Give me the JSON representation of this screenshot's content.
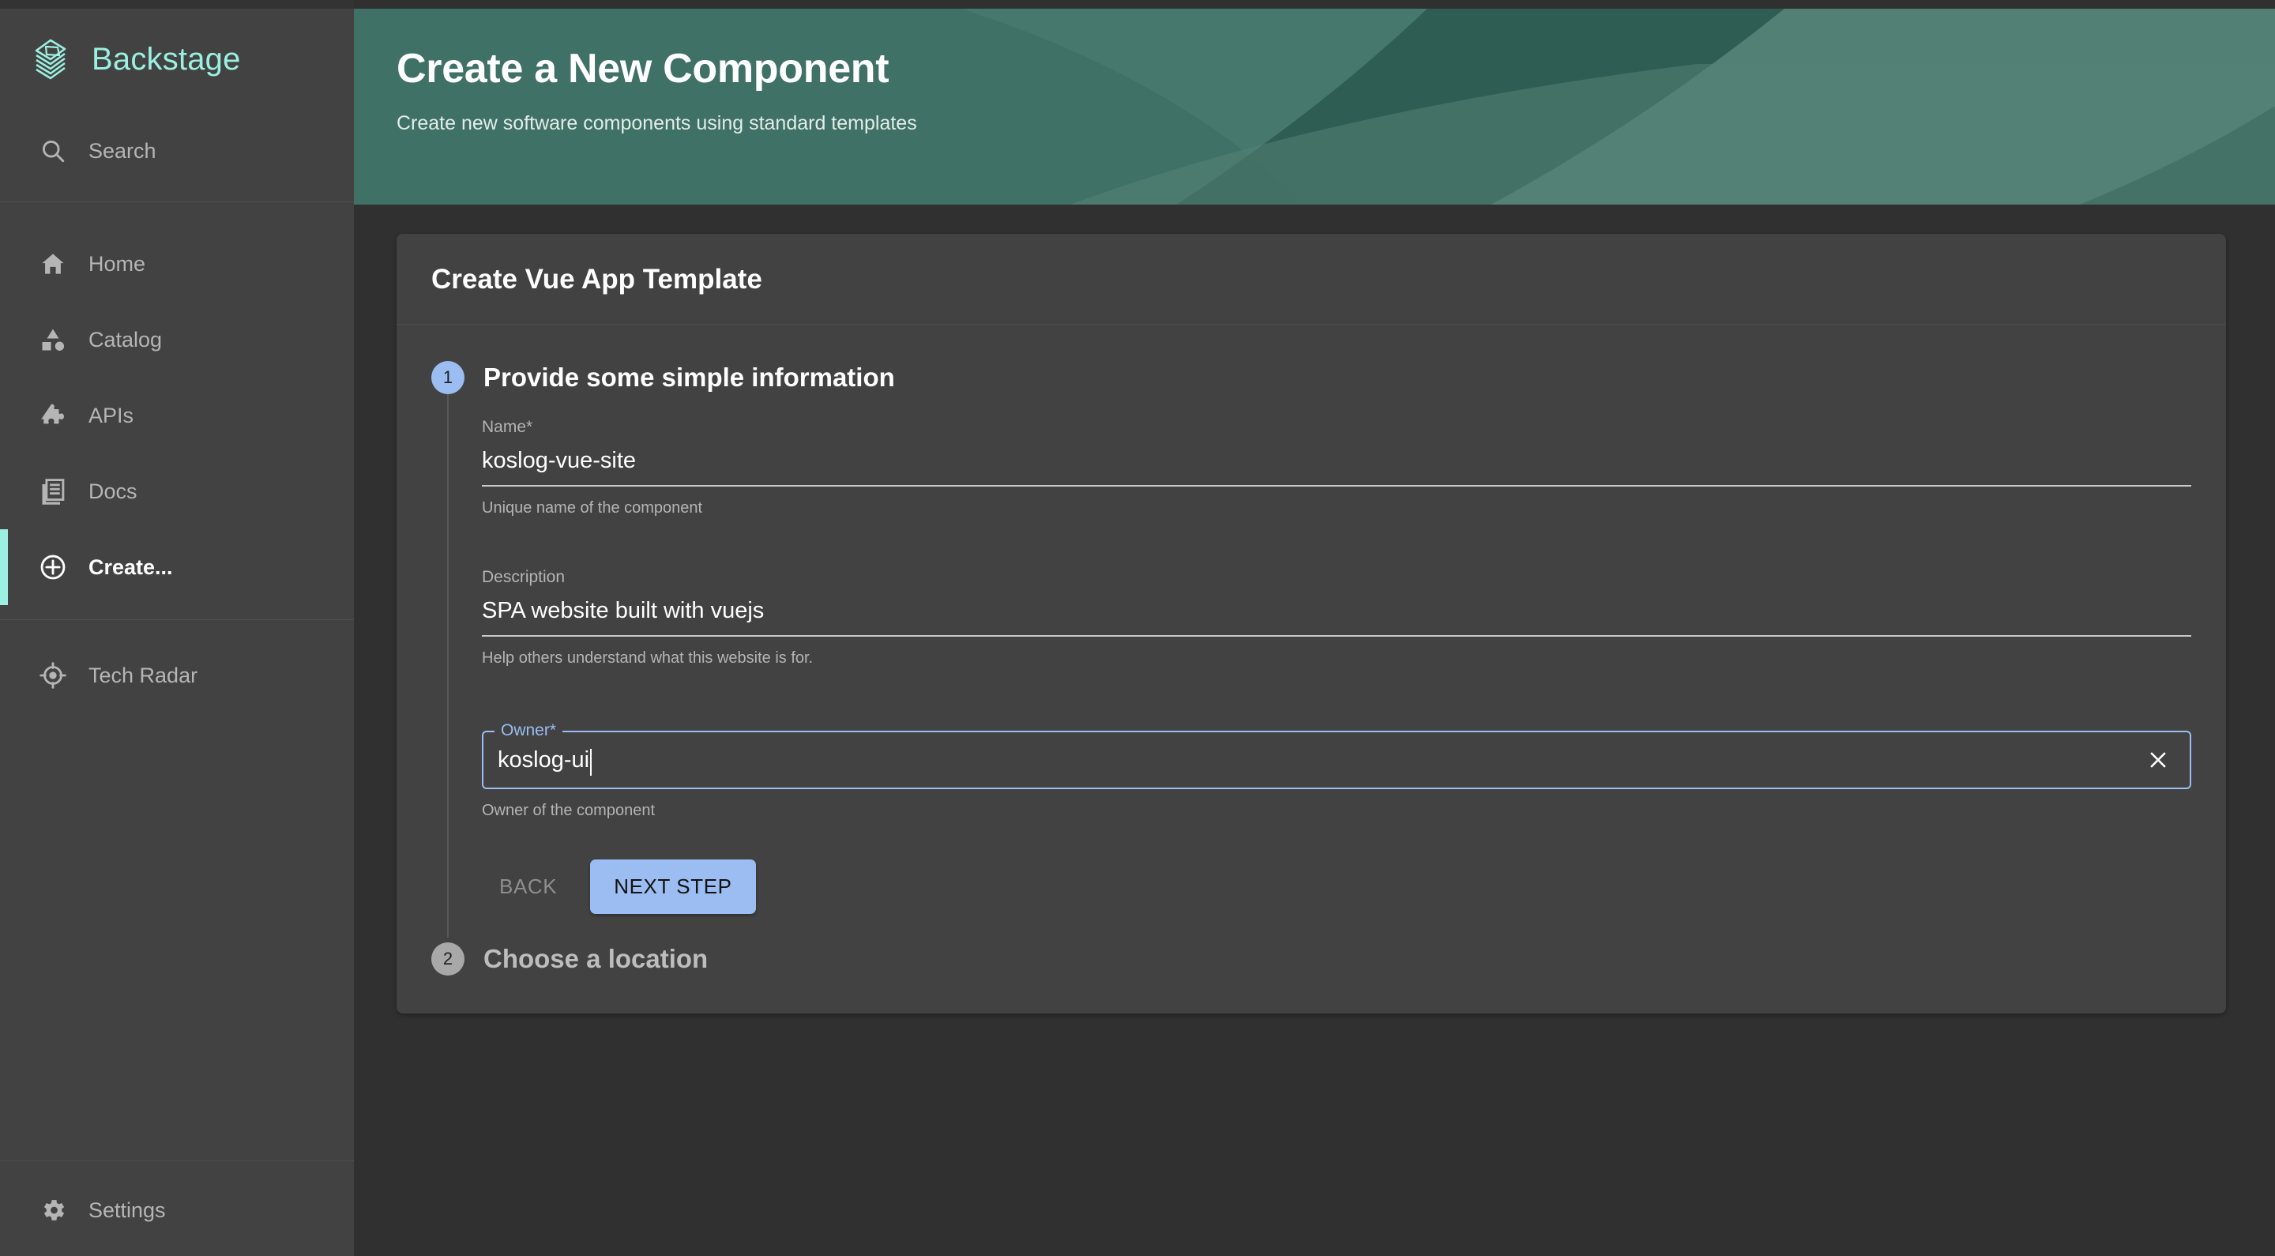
{
  "brand": {
    "name": "Backstage",
    "logo_icon": "backstage-stack-logo",
    "accent_color": "#9bf0e1"
  },
  "sidebar": {
    "search": {
      "label": "Search",
      "icon": "search-icon"
    },
    "items": [
      {
        "label": "Home",
        "icon": "home-icon",
        "active": false
      },
      {
        "label": "Catalog",
        "icon": "catalog-shapes-icon",
        "active": false
      },
      {
        "label": "APIs",
        "icon": "puzzle-piece-icon",
        "active": false
      },
      {
        "label": "Docs",
        "icon": "document-stack-icon",
        "active": false
      },
      {
        "label": "Create...",
        "icon": "plus-circle-icon",
        "active": true
      }
    ],
    "extra_items": [
      {
        "label": "Tech Radar",
        "icon": "radar-target-icon"
      }
    ],
    "bottom_items": [
      {
        "label": "Settings",
        "icon": "gear-icon"
      }
    ]
  },
  "banner": {
    "title": "Create a New Component",
    "subtitle": "Create new software components using standard templates",
    "base_color": "#3f7166",
    "shade_dark": "#27564c",
    "shade_light": "#558277"
  },
  "card": {
    "title": "Create Vue App Template"
  },
  "stepper": {
    "steps": [
      {
        "number": "1",
        "label": "Provide some simple information",
        "state": "active"
      },
      {
        "number": "2",
        "label": "Choose a location",
        "state": "inactive"
      }
    ],
    "active_badge_color": "#9bbdf2",
    "inactive_badge_color": "#a8a8a8"
  },
  "form": {
    "name_field": {
      "label": "Name*",
      "value": "koslog-vue-site",
      "placeholder": "",
      "help": "Unique name of the component"
    },
    "description_field": {
      "label": "Description",
      "value": "SPA website built with vuejs",
      "placeholder": "",
      "help": "Help others understand what this website is for."
    },
    "owner_field": {
      "label": "Owner*",
      "value": "koslog-ui",
      "placeholder": "",
      "help": "Owner of the component",
      "focused": true,
      "clear_icon": "close-x-icon",
      "focus_color": "#9bbdf2"
    }
  },
  "actions": {
    "back_label": "BACK",
    "next_label": "NEXT STEP",
    "next_bg": "#9bbdf2"
  }
}
